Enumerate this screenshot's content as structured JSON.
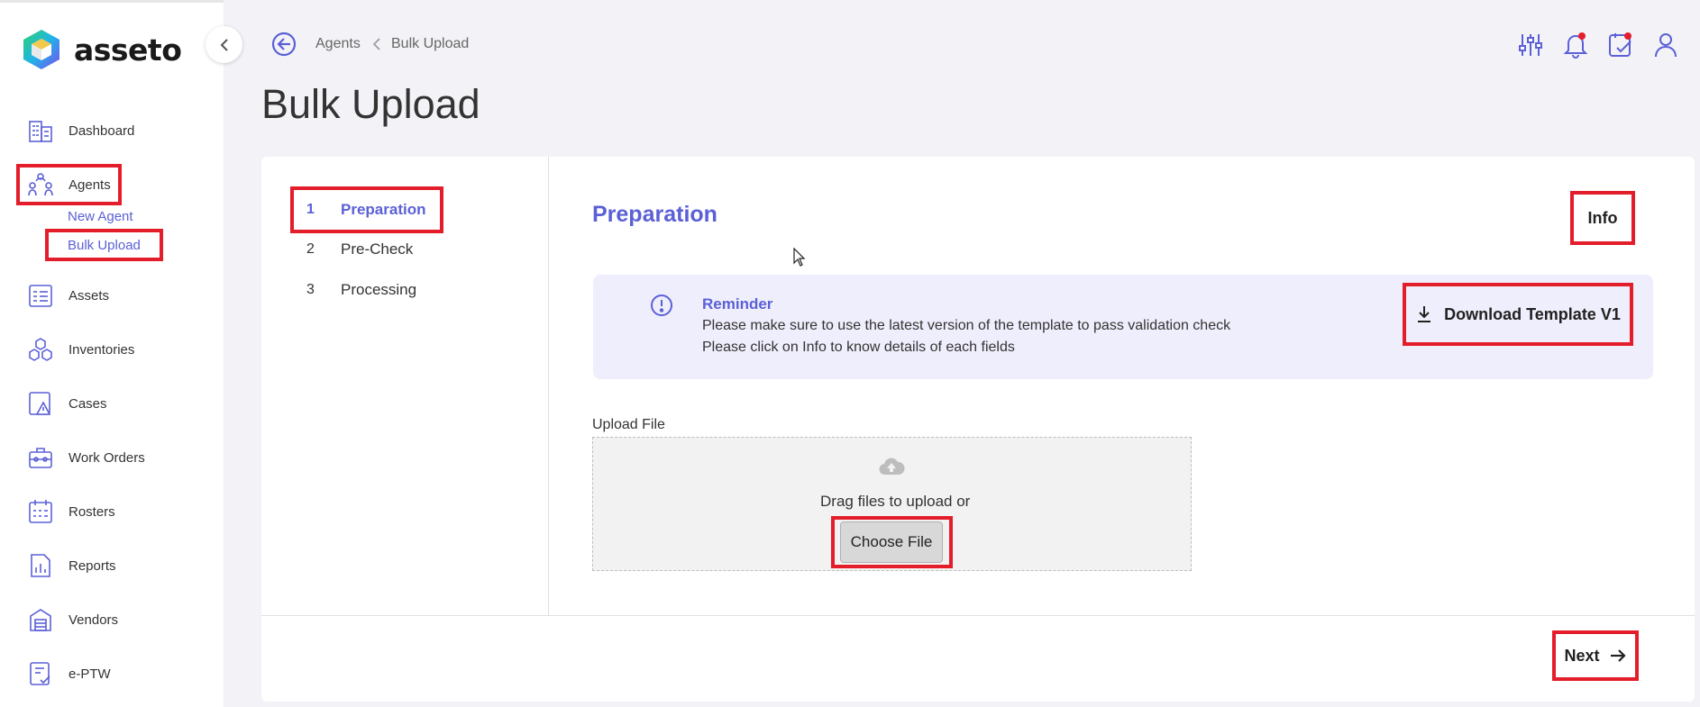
{
  "app": {
    "logo_text": "asseto"
  },
  "sidebar": {
    "items": [
      {
        "label": "Dashboard",
        "icon": "building-icon"
      },
      {
        "label": "Agents",
        "icon": "users-icon"
      },
      {
        "label": "Assets",
        "icon": "assets-icon"
      },
      {
        "label": "Inventories",
        "icon": "boxes-icon"
      },
      {
        "label": "Cases",
        "icon": "case-alert-icon"
      },
      {
        "label": "Work Orders",
        "icon": "toolbox-icon"
      },
      {
        "label": "Rosters",
        "icon": "calendar-icon"
      },
      {
        "label": "Reports",
        "icon": "report-icon"
      },
      {
        "label": "Vendors",
        "icon": "store-icon"
      },
      {
        "label": "e-PTW",
        "icon": "permit-icon"
      }
    ],
    "agents_sub": [
      {
        "label": "New Agent"
      },
      {
        "label": "Bulk Upload"
      }
    ]
  },
  "header": {
    "breadcrumb": [
      "Agents",
      "Bulk Upload"
    ],
    "icons": [
      "sliders-icon",
      "bell-icon",
      "task-icon",
      "user-icon"
    ]
  },
  "page": {
    "title": "Bulk Upload"
  },
  "steps": [
    {
      "num": "1",
      "label": "Preparation",
      "active": true
    },
    {
      "num": "2",
      "label": "Pre-Check",
      "active": false
    },
    {
      "num": "3",
      "label": "Processing",
      "active": false
    }
  ],
  "section": {
    "title": "Preparation",
    "info_label": "Info"
  },
  "reminder": {
    "title": "Reminder",
    "line1": "Please make sure to use the latest version of the template to pass validation check",
    "line2": "Please click on Info to know details of each fields",
    "download_label": "Download Template V1"
  },
  "upload": {
    "label": "Upload File",
    "drag_text": "Drag files to upload or",
    "choose_label": "Choose File"
  },
  "footer": {
    "next_label": "Next"
  },
  "colors": {
    "accent": "#5b60d6",
    "highlight": "#e41d2b",
    "reminder_bg": "#efeefc"
  }
}
